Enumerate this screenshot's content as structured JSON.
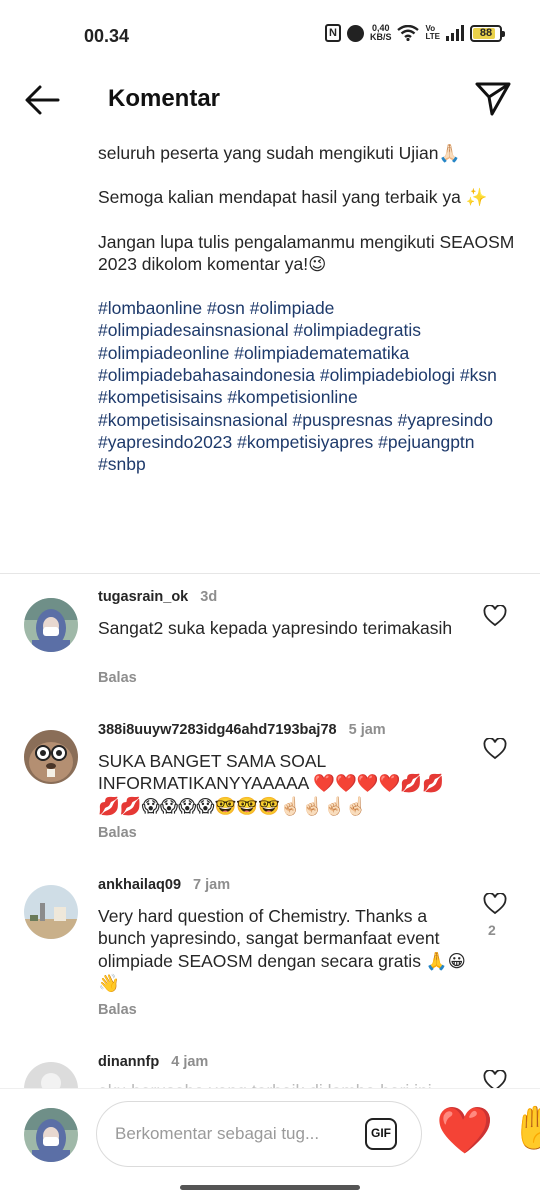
{
  "status_bar": {
    "time": "00.34",
    "nfc": "N",
    "speed_value": "0,40",
    "speed_unit": "KB/S",
    "volte_top": "Vo",
    "volte_bottom": "LTE",
    "battery": "88"
  },
  "header": {
    "title": "Komentar"
  },
  "caption": {
    "paragraphs": [
      "seluruh peserta yang sudah mengikuti Ujian🙏🏻",
      "Semoga kalian mendapat hasil yang terbaik ya ✨",
      "Jangan lupa tulis pengalamanmu mengikuti SEAOSM 2023 dikolom komentar ya!😉"
    ],
    "hashtags": "#lombaonline #osn #olimpiade #olimpiadesainsnasional #olimpiadegratis #olimpiadeonline #olimpiadematematika #olimpiadebahasaindonesia #olimpiadebiologi #ksn #kompetisisains #kompetisionline #kompetisisainsnasional #puspresnas #yapresindo #yapresindo2023 #kompetisiyapres #pejuangptn #snbp"
  },
  "comments": [
    {
      "username": "tugasrain_ok",
      "time": "3d",
      "text": "Sangat2 suka kepada yapresindo terimakasih",
      "reply_label": "Balas",
      "likes": ""
    },
    {
      "username": "388i8uuyw7283idg46ahd7193baj78",
      "time": "5 jam",
      "text": "SUKA BANGET SAMA SOAL INFORMATIKANYYAAAAA ❤️❤️❤️❤️💋💋💋💋😱😱😱😱🤓🤓🤓☝🏻☝🏻☝🏻☝🏻",
      "reply_label": "Balas",
      "likes": ""
    },
    {
      "username": "ankhailaq09",
      "time": "7 jam",
      "text": "Very hard question of Chemistry. Thanks a bunch yapresindo, sangat bermanfaat event olimpiade SEAOSM dengan secara gratis 🙏😀👋",
      "reply_label": "Balas",
      "likes": "2"
    },
    {
      "username": "dinannfp",
      "time": "4 jam",
      "text": "aku berusaha yang terbaik di lomba hari ini",
      "reply_label": "",
      "likes": ""
    }
  ],
  "composer": {
    "placeholder": "Berkomentar sebagai tug...",
    "gif_label": "GIF",
    "heart_emoji": "❤️",
    "wave_emoji": "✋"
  },
  "icons": {
    "back": "back-arrow-icon",
    "share": "paper-plane-icon",
    "like": "heart-outline-icon"
  }
}
